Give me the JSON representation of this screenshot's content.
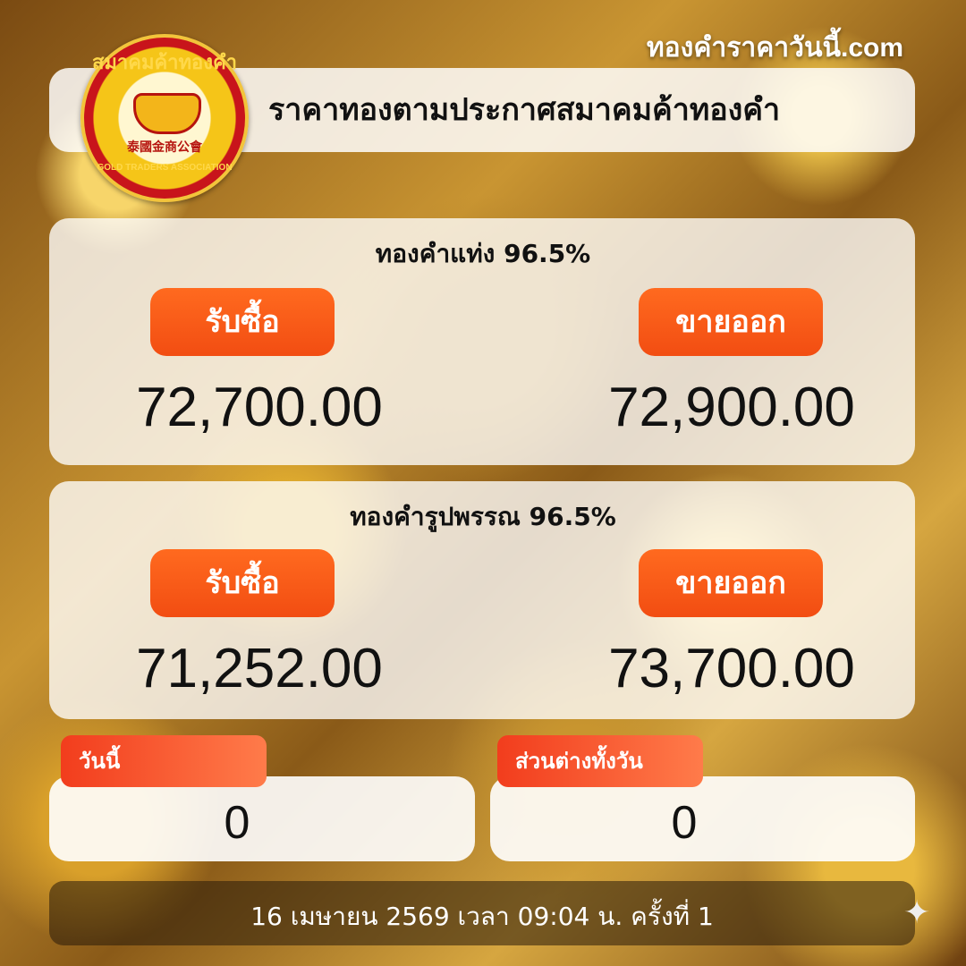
{
  "site_name": "ทองคำราคาวันนี้.com",
  "logo": {
    "ring_top": "สมาคมค้าทองคำ",
    "chinese": "泰國金商公會",
    "ring_bottom": "GOLD TRADERS ASSOCIATION"
  },
  "header": {
    "title": "ราคาทองตามประกาศสมาคมค้าทองคำ"
  },
  "gold_bar": {
    "title": "ทองคำแท่ง 96.5%",
    "buy_label": "รับซื้อ",
    "sell_label": "ขายออก",
    "buy_price": "72,700.00",
    "sell_price": "72,900.00"
  },
  "gold_ornament": {
    "title": "ทองคำรูปพรรณ 96.5%",
    "buy_label": "รับซื้อ",
    "sell_label": "ขายออก",
    "buy_price": "71,252.00",
    "sell_price": "73,700.00"
  },
  "today": {
    "label": "วันนี้",
    "value": "0"
  },
  "day_difference": {
    "label": "ส่วนต่างทั้งวัน",
    "value": "0"
  },
  "footer": {
    "text": "16 เมษายน 2569 เวลา 09:04 น. ครั้งที่ 1"
  },
  "colors": {
    "accent": "#f24d12",
    "tag": "#f23d1d"
  }
}
